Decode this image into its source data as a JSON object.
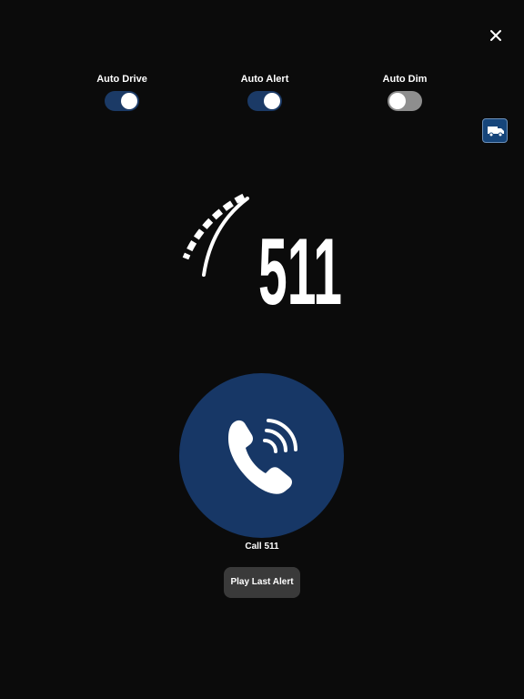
{
  "status_bar": {
    "left_text": "",
    "right_text": ""
  },
  "header": {
    "close_icon": "close-icon"
  },
  "toggles": [
    {
      "label": "Auto Drive",
      "state": "on"
    },
    {
      "label": "Auto Alert",
      "state": "on"
    },
    {
      "label": "Auto Dim",
      "state": "off"
    }
  ],
  "truck_button": {
    "icon": "truck-icon"
  },
  "logo": {
    "text": "511",
    "icon": "road-lines-icon"
  },
  "call": {
    "label": "Call 511",
    "icon": "phone-ringing-icon"
  },
  "play_button": {
    "label": "Play Last Alert"
  },
  "colors": {
    "background": "#0b0b0b",
    "accent_blue": "#173766",
    "toggle_on": "#1b3a66",
    "toggle_off": "#8e8e8e",
    "button_gray": "#3a3a3a"
  }
}
